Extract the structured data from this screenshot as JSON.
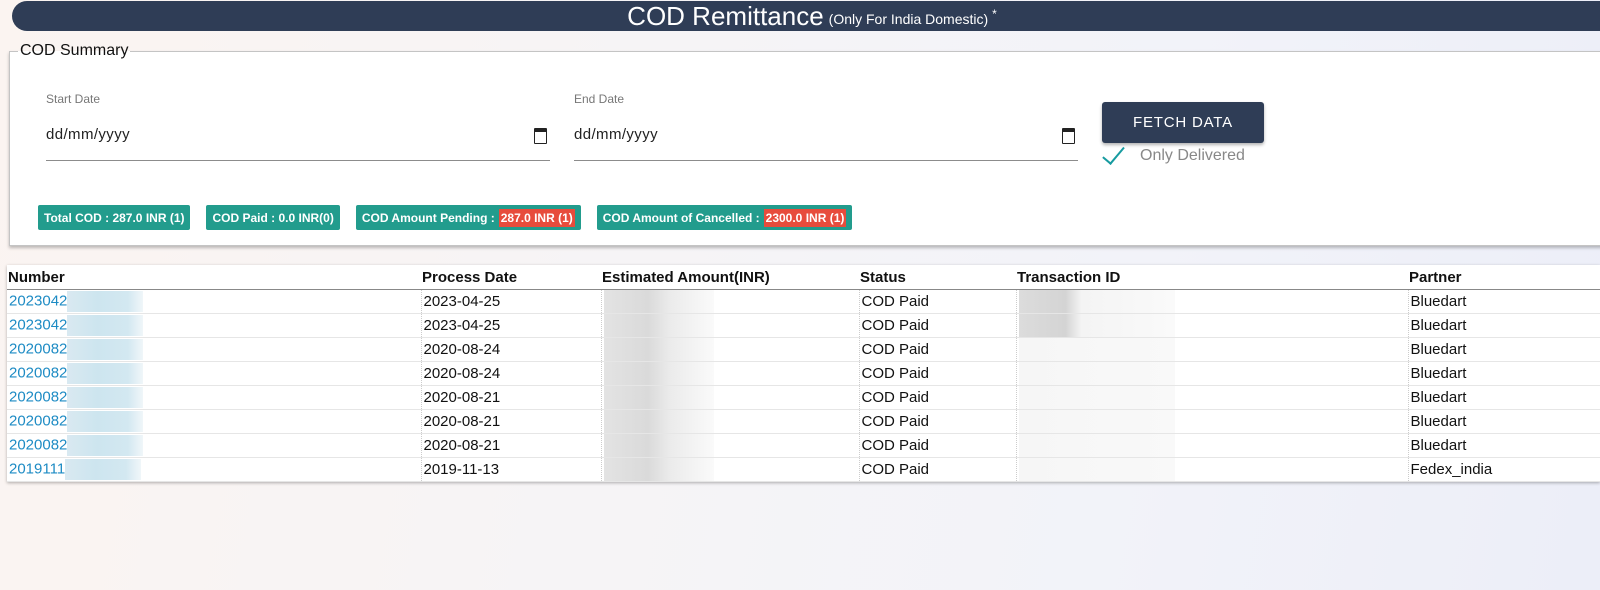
{
  "header": {
    "title": "COD Remittance",
    "subtitle": "(Only For India Domestic)",
    "marker": "*"
  },
  "summary": {
    "legend": "COD Summary",
    "start_date": {
      "label": "Start Date",
      "value": "dd/mm/yyyy"
    },
    "end_date": {
      "label": "End Date",
      "value": "dd/mm/yyyy"
    },
    "fetch_label": "FETCH DATA",
    "only_delivered_label": "Only Delivered",
    "badges": [
      {
        "label": "Total COD :",
        "value": "287.0 INR (1)",
        "highlight": false
      },
      {
        "label": "COD Paid :",
        "value": "0.0 INR(0)",
        "highlight": false
      },
      {
        "label": "COD Amount Pending :",
        "value": "287.0 INR (1)",
        "highlight": true
      },
      {
        "label": "COD Amount of Cancelled :",
        "value": "2300.0 INR (1)",
        "highlight": true
      }
    ]
  },
  "colors": {
    "header_bg": "#2f3d56",
    "badge_bg": "#229c8d",
    "highlight": "#e74c3c",
    "link": "#1d8bc4"
  },
  "table": {
    "columns": [
      "Number",
      "Process Date",
      "Estimated Amount(INR)",
      "Status",
      "Transaction ID",
      "Partner"
    ],
    "rows": [
      {
        "number": "2023042",
        "date": "2023-04-25",
        "status": "COD Paid",
        "partner": "Bluedart"
      },
      {
        "number": "2023042",
        "date": "2023-04-25",
        "status": "COD Paid",
        "partner": "Bluedart"
      },
      {
        "number": "2020082",
        "date": "2020-08-24",
        "status": "COD Paid",
        "partner": "Bluedart"
      },
      {
        "number": "2020082",
        "date": "2020-08-24",
        "status": "COD Paid",
        "partner": "Bluedart"
      },
      {
        "number": "2020082",
        "date": "2020-08-21",
        "status": "COD Paid",
        "partner": "Bluedart"
      },
      {
        "number": "2020082",
        "date": "2020-08-21",
        "status": "COD Paid",
        "partner": "Bluedart"
      },
      {
        "number": "2020082",
        "date": "2020-08-21",
        "status": "COD Paid",
        "partner": "Bluedart"
      },
      {
        "number": "2019111",
        "date": "2019-11-13",
        "status": "COD Paid",
        "partner": "Fedex_india"
      }
    ]
  }
}
